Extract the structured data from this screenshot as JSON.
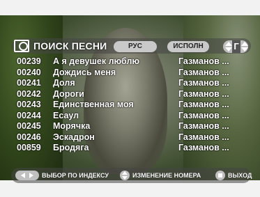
{
  "header": {
    "title": "ПОИСК ПЕСНИ",
    "lang_button": "РУС",
    "artist_button": "ИСПОЛН",
    "letter": "Г"
  },
  "songs": [
    {
      "num": "00239",
      "name": "А я девушек люблю",
      "artist": "Газманов ..."
    },
    {
      "num": "00240",
      "name": "Дождись меня",
      "artist": "Газманов ..."
    },
    {
      "num": "00241",
      "name": "Доля",
      "artist": "Газманов ..."
    },
    {
      "num": "00242",
      "name": "Дороги",
      "artist": "Газманов ..."
    },
    {
      "num": "00243",
      "name": "Единственная моя",
      "artist": "Газманов ..."
    },
    {
      "num": "00244",
      "name": "Есаул",
      "artist": "Газманов ..."
    },
    {
      "num": "00245",
      "name": "Морячка",
      "artist": "Газманов ..."
    },
    {
      "num": "00246",
      "name": "Эскадрон",
      "artist": "Газманов ..."
    },
    {
      "num": "00859",
      "name": "Бродяга",
      "artist": "Газманов ..."
    }
  ],
  "footer": {
    "index_select": "ВЫБОР ПО ИНДЕКСУ",
    "change_number": "ИЗМЕНЕНИЕ НОМЕРА",
    "exit": "ВЫХОД"
  }
}
